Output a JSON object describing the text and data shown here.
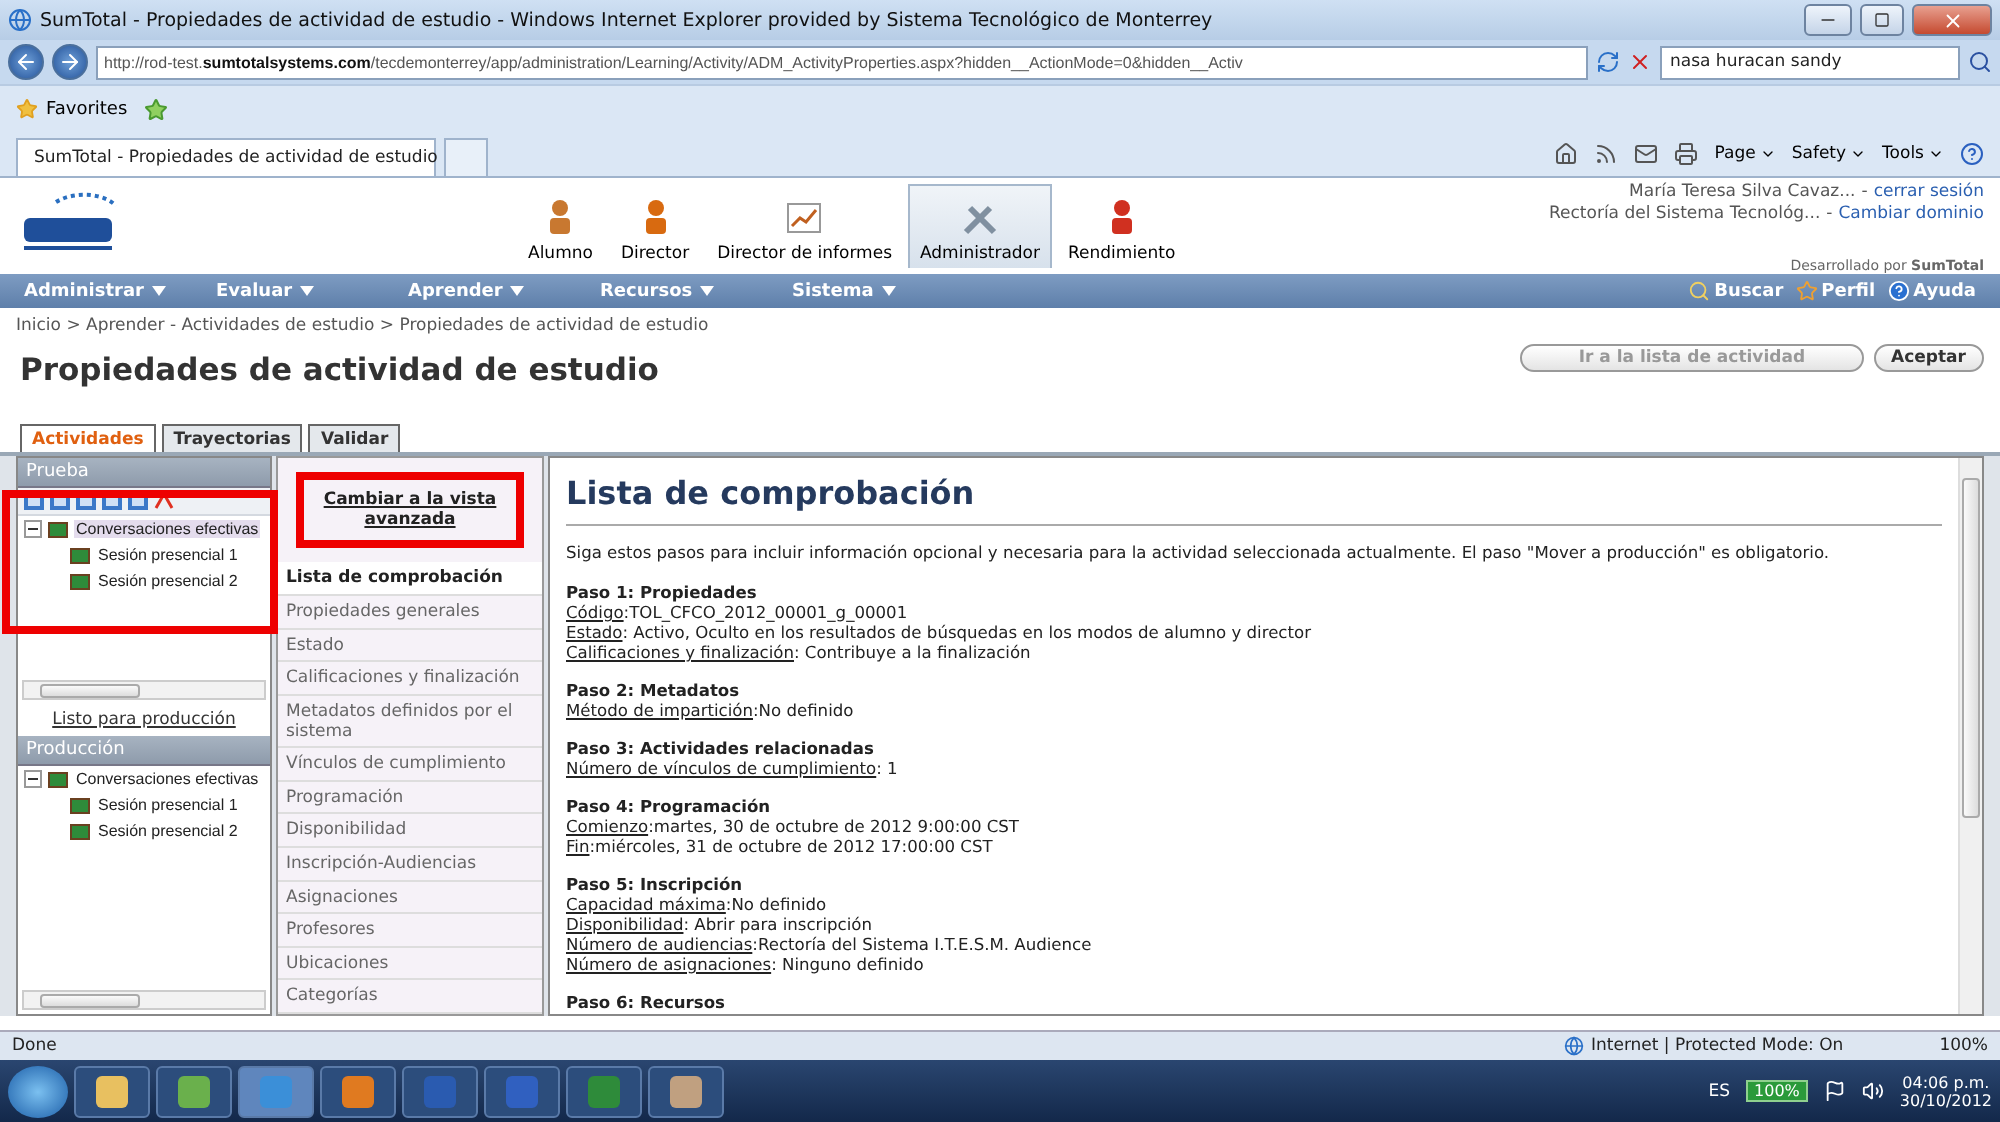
{
  "window": {
    "title": "SumTotal - Propiedades de actividad de estudio - Windows Internet Explorer provided by Sistema Tecnológico de Monterrey"
  },
  "address": {
    "url_prefix": "http://rod-test.",
    "url_domain": "sumtotalsystems.com",
    "url_rest": "/tecdemonterrey/app/administration/Learning/Activity/ADM_ActivityProperties.aspx?hidden__ActionMode=0&hidden__Activ",
    "search_value": "nasa huracan sandy"
  },
  "favorites": {
    "label": "Favorites"
  },
  "browser_tab": {
    "title": "SumTotal - Propiedades de actividad de estudio"
  },
  "command_bar": [
    {
      "label": "Page"
    },
    {
      "label": "Safety"
    },
    {
      "label": "Tools"
    }
  ],
  "header": {
    "user_name": "María Teresa Silva Cavaz...",
    "user_separator": "-",
    "logout": "cerrar sesión",
    "org": "Rectoría del Sistema Tecnológ...",
    "org_separator": "-",
    "change_domain": "Cambiar dominio",
    "developed_by": "Desarrollado por **SumTotal**"
  },
  "roles": [
    {
      "label": "Alumno",
      "selected": false
    },
    {
      "label": "Director",
      "selected": false
    },
    {
      "label": "Director de informes",
      "selected": false
    },
    {
      "label": "Administrador",
      "selected": true
    },
    {
      "label": "Rendimiento",
      "selected": false
    }
  ],
  "menu": [
    {
      "label": "Administrar"
    },
    {
      "label": "Evaluar"
    },
    {
      "label": "Aprender"
    },
    {
      "label": "Recursos"
    },
    {
      "label": "Sistema"
    }
  ],
  "menu_links": [
    {
      "label": "Buscar"
    },
    {
      "label": "Perfil"
    },
    {
      "label": "Ayuda"
    }
  ],
  "breadcrumb": "Inicio > Aprender - Actividades de estudio > Propiedades de actividad de estudio",
  "page_title": "Propiedades de actividad de estudio",
  "buttons": [
    {
      "label": "Ir a la lista de actividad",
      "disabled": true
    },
    {
      "label": "Aceptar",
      "disabled": false
    }
  ],
  "tabs": [
    {
      "label": "Actividades",
      "selected": true
    },
    {
      "label": "Trayectorias",
      "selected": false
    },
    {
      "label": "Validar",
      "selected": false
    }
  ],
  "trees": [
    {
      "title": "Prueba",
      "highlighted": true,
      "toolbar": true,
      "footer_link": "Listo para producción",
      "root": {
        "label": "Conversaciones efectivas",
        "expanded": true,
        "selected": true,
        "children": [
          {
            "label": "Sesión presencial 1"
          },
          {
            "label": "Sesión presencial 2"
          }
        ]
      }
    },
    {
      "title": "Producción",
      "root": {
        "label": "Conversaciones efectivas",
        "expanded": true,
        "selected": false,
        "children": [
          {
            "label": "Sesión presencial 1"
          },
          {
            "label": "Sesión presencial 2"
          }
        ]
      }
    }
  ],
  "nav": {
    "advanced_link": "Cambiar a la vista avanzada",
    "advanced_highlighted": true,
    "items": [
      {
        "label": "Lista de comprobación",
        "selected": true
      },
      {
        "label": "Propiedades generales",
        "selected": false
      },
      {
        "label": "Estado",
        "selected": false
      },
      {
        "label": "Calificaciones y finalización",
        "selected": false
      },
      {
        "label": "Metadatos definidos por el sistema",
        "selected": false
      },
      {
        "label": "Vínculos de cumplimiento",
        "selected": false
      },
      {
        "label": "Programación",
        "selected": false
      },
      {
        "label": "Disponibilidad",
        "selected": false
      },
      {
        "label": "Inscripción-Audiencias",
        "selected": false
      },
      {
        "label": "Asignaciones",
        "selected": false
      },
      {
        "label": "Profesores",
        "selected": false
      },
      {
        "label": "Ubicaciones",
        "selected": false
      },
      {
        "label": "Categorías",
        "selected": false
      }
    ]
  },
  "content": {
    "heading": "Lista de comprobación",
    "intro": "Siga estos pasos para incluir información opcional y necesaria para la actividad seleccionada actualmente. El paso \"Mover a producción\" es obligatorio.",
    "steps": [
      {
        "title": "Paso 1: Propiedades",
        "lines": [
          {
            "label": "Código",
            "value": ":TOL_CFCO_2012_00001_g_00001"
          },
          {
            "label": "Estado",
            "value": ": Activo, Oculto en los resultados de búsquedas en los modos de alumno y director"
          },
          {
            "label": "Calificaciones y finalización",
            "value": ": Contribuye a la finalización"
          }
        ]
      },
      {
        "title": "Paso 2: Metadatos",
        "lines": [
          {
            "label": "Método de impartición",
            "value": ":No definido"
          }
        ]
      },
      {
        "title": "Paso 3: Actividades relacionadas",
        "lines": [
          {
            "label": "Número de vínculos de cumplimiento",
            "value": ": 1"
          }
        ]
      },
      {
        "title": "Paso 4: Programación",
        "lines": [
          {
            "label": "Comienzo",
            "value": ":martes, 30 de octubre de 2012 9:00:00 CST"
          },
          {
            "label": "Fin",
            "value": ":miércoles, 31 de octubre de 2012 17:00:00 CST"
          }
        ]
      },
      {
        "title": "Paso 5: Inscripción",
        "lines": [
          {
            "label": "Capacidad máxima",
            "value": ":No definido"
          },
          {
            "label": "Disponibilidad",
            "value": ": Abrir para inscripción"
          },
          {
            "label": "Número de audiencias",
            "value": ":Rectoría del Sistema I.T.E.S.M. Audience"
          },
          {
            "label": "Número de asignaciones",
            "value": ": Ninguno definido"
          }
        ]
      },
      {
        "title": "Paso 6: Recursos"
      }
    ]
  },
  "status_bar": {
    "text": "Done",
    "zone": "Internet | Protected Mode: On",
    "zoom": "100%"
  },
  "taskbar": {
    "apps": [
      {
        "color": "#e8c060"
      },
      {
        "color": "#6ab04c"
      },
      {
        "color": "#3b8fd8"
      },
      {
        "color": "#e07a20"
      },
      {
        "color": "#2a5bb0"
      },
      {
        "color": "#3060c0"
      },
      {
        "color": "#2e8b3a"
      },
      {
        "color": "#c0a080"
      }
    ],
    "language": "ES",
    "battery": "100%",
    "time": "04:06 p.m.",
    "date": "30/10/2012"
  }
}
